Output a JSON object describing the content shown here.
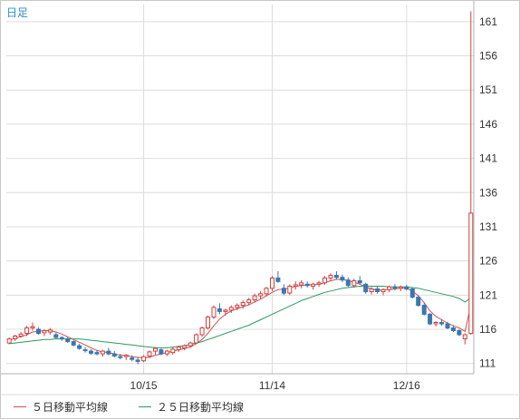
{
  "period_label": "日足",
  "colors": {
    "ma5": "#d05050",
    "ma25": "#2a9a60",
    "up_candle_border": "#d04040",
    "down_candle": "#3a76b0",
    "grid": "#dcdcdc",
    "axis": "#b0b0b0"
  },
  "legend": {
    "ma5_label": "５日移動平均線",
    "ma25_label": "２５日移動平均線"
  },
  "chart_data": {
    "type": "candlestick",
    "y_ticks": [
      111,
      116,
      121,
      126,
      131,
      136,
      141,
      146,
      151,
      156,
      161
    ],
    "ylim": [
      109.5,
      163.5
    ],
    "x_tick_labels": [
      {
        "label": "10/15",
        "index": 23
      },
      {
        "label": "11/14",
        "index": 45
      },
      {
        "label": "12/16",
        "index": 68
      }
    ],
    "grid": true,
    "legend_placement": "bottom-left",
    "candles": [
      [
        114.0,
        114.8,
        113.8,
        114.6
      ],
      [
        114.6,
        115.2,
        114.3,
        115.0
      ],
      [
        115.0,
        115.6,
        114.8,
        115.3
      ],
      [
        115.4,
        116.5,
        115.0,
        116.2
      ],
      [
        116.2,
        117.0,
        115.8,
        116.4
      ],
      [
        116.0,
        116.3,
        115.2,
        115.4
      ],
      [
        115.5,
        116.0,
        115.0,
        115.8
      ],
      [
        115.6,
        116.2,
        115.2,
        115.9
      ],
      [
        115.2,
        115.5,
        114.6,
        114.8
      ],
      [
        114.8,
        115.0,
        114.3,
        114.6
      ],
      [
        114.6,
        114.9,
        114.0,
        114.2
      ],
      [
        114.2,
        114.4,
        113.5,
        113.7
      ],
      [
        113.6,
        113.9,
        113.0,
        113.2
      ],
      [
        113.0,
        113.4,
        112.6,
        112.9
      ],
      [
        112.8,
        113.1,
        112.3,
        112.5
      ],
      [
        112.6,
        113.0,
        112.2,
        112.4
      ],
      [
        112.4,
        113.0,
        112.0,
        112.8
      ],
      [
        112.8,
        113.3,
        112.2,
        112.4
      ],
      [
        112.4,
        112.8,
        111.9,
        112.1
      ],
      [
        112.0,
        112.4,
        111.6,
        111.9
      ],
      [
        112.0,
        112.4,
        111.5,
        112.2
      ],
      [
        111.8,
        112.2,
        111.3,
        111.6
      ],
      [
        111.5,
        111.9,
        110.9,
        111.3
      ],
      [
        111.4,
        112.2,
        111.2,
        112.0
      ],
      [
        112.1,
        112.9,
        111.8,
        112.7
      ],
      [
        112.8,
        113.4,
        112.3,
        113.2
      ],
      [
        113.0,
        113.2,
        112.2,
        112.4
      ],
      [
        112.4,
        113.0,
        112.1,
        112.8
      ],
      [
        112.6,
        113.4,
        112.3,
        113.1
      ],
      [
        113.0,
        113.6,
        112.7,
        113.4
      ],
      [
        113.3,
        113.8,
        112.9,
        113.6
      ],
      [
        113.6,
        114.2,
        113.3,
        114.0
      ],
      [
        114.0,
        115.4,
        113.8,
        115.2
      ],
      [
        115.2,
        116.4,
        114.9,
        116.2
      ],
      [
        116.2,
        118.0,
        116.0,
        117.8
      ],
      [
        117.8,
        119.5,
        117.5,
        119.2
      ],
      [
        119.0,
        119.8,
        118.2,
        118.6
      ],
      [
        118.6,
        119.0,
        118.0,
        118.8
      ],
      [
        118.8,
        119.5,
        118.4,
        119.2
      ],
      [
        119.2,
        119.8,
        118.8,
        119.5
      ],
      [
        119.5,
        120.2,
        119.0,
        119.9
      ],
      [
        119.9,
        120.6,
        119.5,
        120.3
      ],
      [
        120.3,
        121.2,
        119.9,
        120.9
      ],
      [
        120.9,
        121.6,
        120.4,
        121.2
      ],
      [
        121.2,
        122.2,
        120.8,
        122.0
      ],
      [
        122.0,
        123.8,
        121.6,
        123.5
      ],
      [
        123.5,
        124.5,
        122.8,
        123.0
      ],
      [
        122.0,
        122.6,
        121.0,
        121.3
      ],
      [
        121.3,
        122.6,
        121.0,
        122.3
      ],
      [
        122.3,
        123.0,
        121.8,
        122.5
      ],
      [
        122.5,
        123.2,
        122.0,
        122.8
      ],
      [
        122.6,
        123.0,
        122.1,
        122.4
      ],
      [
        122.3,
        122.8,
        121.8,
        122.6
      ],
      [
        122.6,
        123.1,
        122.2,
        122.8
      ],
      [
        122.8,
        123.8,
        122.5,
        123.5
      ],
      [
        123.5,
        124.2,
        123.0,
        123.9
      ],
      [
        123.9,
        124.5,
        123.3,
        123.6
      ],
      [
        123.6,
        124.0,
        122.9,
        123.2
      ],
      [
        123.2,
        123.6,
        122.2,
        122.4
      ],
      [
        122.4,
        123.4,
        122.1,
        123.1
      ],
      [
        123.1,
        123.8,
        122.6,
        122.8
      ],
      [
        122.6,
        122.8,
        121.2,
        121.5
      ],
      [
        121.5,
        122.2,
        121.1,
        121.9
      ],
      [
        121.9,
        122.3,
        121.2,
        121.5
      ],
      [
        121.5,
        122.0,
        121.0,
        121.8
      ],
      [
        121.8,
        122.4,
        121.4,
        122.2
      ],
      [
        122.2,
        122.6,
        121.7,
        122.0
      ],
      [
        122.0,
        122.4,
        121.6,
        122.2
      ],
      [
        122.2,
        122.5,
        121.7,
        121.9
      ],
      [
        121.9,
        122.1,
        120.5,
        120.7
      ],
      [
        120.7,
        121.0,
        119.3,
        119.5
      ],
      [
        119.5,
        119.8,
        118.0,
        118.2
      ],
      [
        118.2,
        118.4,
        116.6,
        116.8
      ],
      [
        116.8,
        117.2,
        116.4,
        117.0
      ],
      [
        117.0,
        117.5,
        116.5,
        116.8
      ],
      [
        116.8,
        117.1,
        116.0,
        116.2
      ],
      [
        116.2,
        116.6,
        115.6,
        115.8
      ],
      [
        115.8,
        116.0,
        115.0,
        115.2
      ],
      [
        114.6,
        115.4,
        113.8,
        115.2
      ],
      [
        115.4,
        162.5,
        115.2,
        133.0
      ]
    ],
    "ma5": [
      114.4,
      114.7,
      114.9,
      115.2,
      115.6,
      115.7,
      115.8,
      115.8,
      115.6,
      115.3,
      114.9,
      114.5,
      114.1,
      113.7,
      113.3,
      112.9,
      112.7,
      112.6,
      112.4,
      112.2,
      112.2,
      112.0,
      111.9,
      111.8,
      111.9,
      112.2,
      112.4,
      112.6,
      112.8,
      113.0,
      113.2,
      113.4,
      113.9,
      114.5,
      115.4,
      116.5,
      117.5,
      118.2,
      118.7,
      119.0,
      119.3,
      119.6,
      120.0,
      120.4,
      120.9,
      121.4,
      121.8,
      121.9,
      122.0,
      122.3,
      122.4,
      122.5,
      122.5,
      122.6,
      122.8,
      123.1,
      123.3,
      123.3,
      123.1,
      122.9,
      122.6,
      122.2,
      121.9,
      121.7,
      121.8,
      121.8,
      121.9,
      122.0,
      122.0,
      121.6,
      120.9,
      119.9,
      118.7,
      117.9,
      117.4,
      116.9,
      116.5,
      116.2,
      115.7,
      119.5
    ],
    "ma25": [
      113.9,
      114.0,
      114.1,
      114.2,
      114.3,
      114.4,
      114.5,
      114.5,
      114.6,
      114.6,
      114.6,
      114.6,
      114.6,
      114.5,
      114.4,
      114.3,
      114.2,
      114.1,
      114.0,
      113.9,
      113.8,
      113.7,
      113.6,
      113.5,
      113.4,
      113.3,
      113.3,
      113.3,
      113.4,
      113.5,
      113.6,
      113.8,
      114.0,
      114.2,
      114.5,
      114.8,
      115.1,
      115.4,
      115.7,
      116.0,
      116.3,
      116.6,
      117.0,
      117.4,
      117.8,
      118.2,
      118.6,
      119.0,
      119.4,
      119.8,
      120.2,
      120.5,
      120.8,
      121.1,
      121.4,
      121.6,
      121.8,
      122.0,
      122.1,
      122.2,
      122.3,
      122.3,
      122.3,
      122.3,
      122.3,
      122.2,
      122.2,
      122.2,
      122.2,
      122.1,
      122.0,
      121.8,
      121.6,
      121.4,
      121.2,
      121.0,
      120.8,
      120.5,
      120.0,
      120.6
    ]
  }
}
